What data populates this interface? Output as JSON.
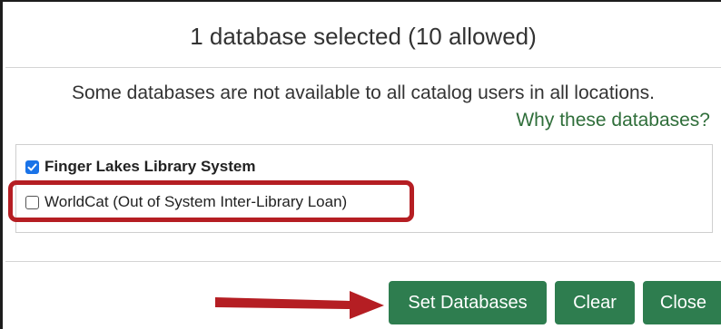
{
  "dialog": {
    "title": "1 database selected (10 allowed)",
    "notice": "Some databases are not available to all catalog users in all locations.",
    "why_link": "Why these databases?"
  },
  "databases": [
    {
      "label": "Finger Lakes Library System",
      "checked": true
    },
    {
      "label": "WorldCat (Out of System Inter-Library Loan)",
      "checked": false
    }
  ],
  "buttons": {
    "set_label": "Set Databases",
    "clear_label": "Clear",
    "close_label": "Close"
  },
  "colors": {
    "button_green": "#2e7d4f",
    "link_green": "#2f6e3a",
    "annotation_red": "#b51e23",
    "checkbox_blue": "#1a73e8"
  },
  "icons": {
    "annotation_arrow": "arrow-right-icon",
    "annotation_box": "highlight-box",
    "checked": "checkmark-icon"
  }
}
